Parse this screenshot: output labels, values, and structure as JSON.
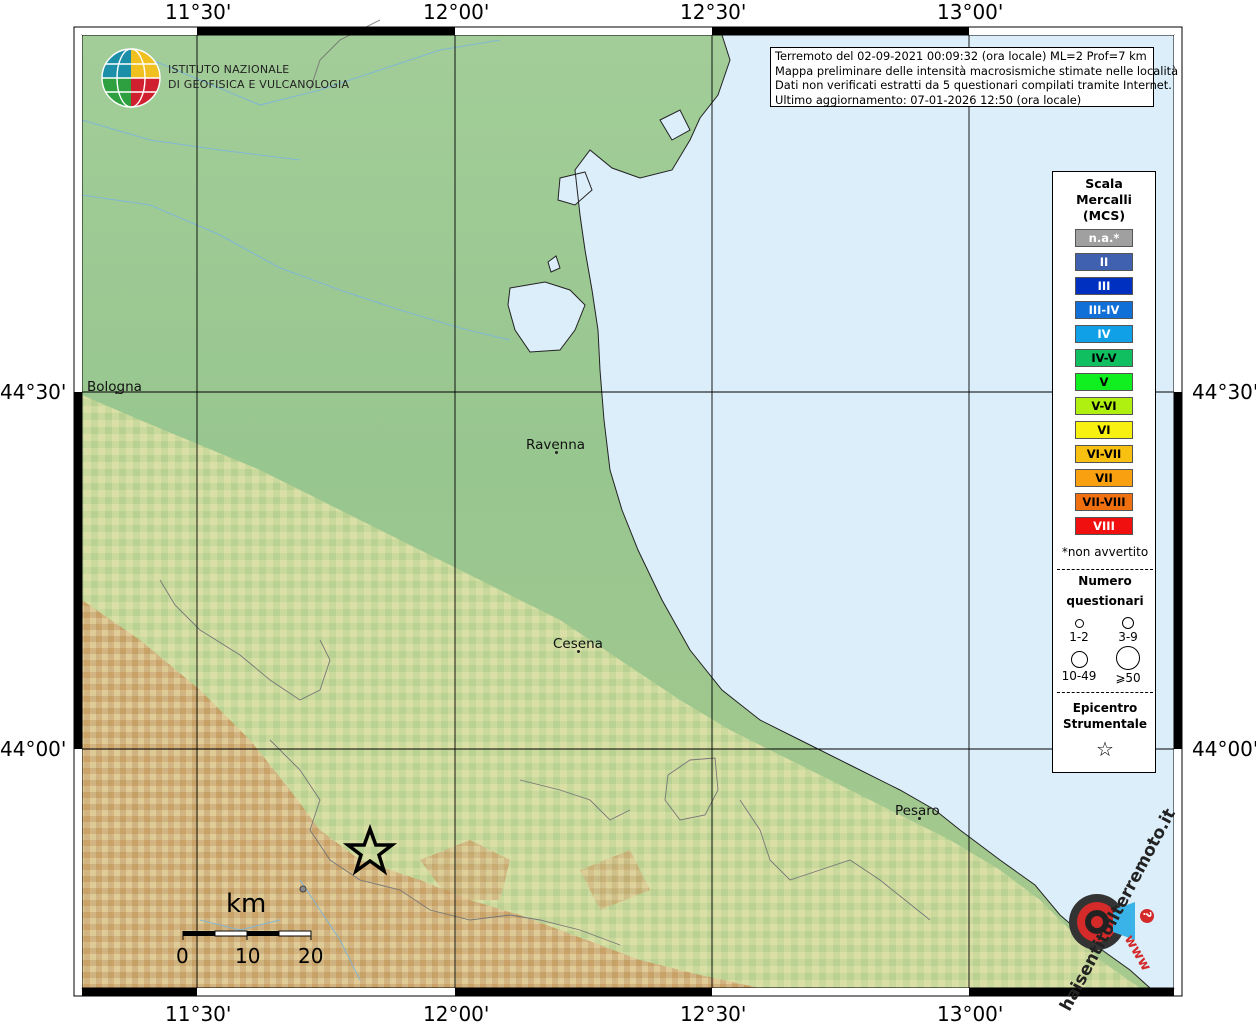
{
  "map": {
    "coord_labels": {
      "top": [
        "11°30'",
        "12°00'",
        "12°30'",
        "13°00'"
      ],
      "bottom": [
        "11°30'",
        "12°00'",
        "12°30'",
        "13°00'"
      ],
      "left": [
        "44°30'",
        "44°00'"
      ],
      "right": [
        "44°30'",
        "44°00'"
      ]
    },
    "cities": [
      "Bologna",
      "Ravenna",
      "Cesena",
      "Pesaro"
    ]
  },
  "logo": {
    "line1": "ISTITUTO NAZIONALE",
    "line2": "DI GEOFISICA E VULCANOLOGIA"
  },
  "info": {
    "line1": "Terremoto del 02-09-2021 00:09:32 (ora locale) ML=2 Prof=7 km",
    "line2": "Mappa preliminare delle intensità macrosismiche stimate nelle località",
    "line3": "Dati non verificati estratti da 5 questionari compilati tramite Internet.",
    "line4": "Ultimo aggiornamento: 07-01-2026 12:50 (ora locale)"
  },
  "legend": {
    "title1": "Scala",
    "title2": "Mercalli",
    "title3": "(MCS)",
    "items": [
      {
        "label": "n.a.*",
        "color": "#a0a0a0",
        "text_color": "#ffffff"
      },
      {
        "label": "II",
        "color": "#4060b0",
        "text_color": "#ffffff"
      },
      {
        "label": "III",
        "color": "#0030c0",
        "text_color": "#ffffff"
      },
      {
        "label": "III-IV",
        "color": "#1070d8",
        "text_color": "#ffffff"
      },
      {
        "label": "IV",
        "color": "#10a0e8",
        "text_color": "#ffffff"
      },
      {
        "label": "IV-V",
        "color": "#10c060",
        "text_color": "#000000"
      },
      {
        "label": "V",
        "color": "#10f020",
        "text_color": "#000000"
      },
      {
        "label": "V-VI",
        "color": "#b0f010",
        "text_color": "#000000"
      },
      {
        "label": "VI",
        "color": "#f8f010",
        "text_color": "#000000"
      },
      {
        "label": "VI-VII",
        "color": "#f8c010",
        "text_color": "#000000"
      },
      {
        "label": "VII",
        "color": "#f8a010",
        "text_color": "#000000"
      },
      {
        "label": "VII-VIII",
        "color": "#f07010",
        "text_color": "#000000"
      },
      {
        "label": "VIII",
        "color": "#f01010",
        "text_color": "#ffffff"
      }
    ],
    "note": "*non avvertito",
    "count_title1": "Numero",
    "count_title2": "questionari",
    "count_labels": [
      "1-2",
      "3-9",
      "10-49",
      "⩾50"
    ],
    "epi_title1": "Epicentro",
    "epi_title2": "Strumentale",
    "epi_symbol": "☆"
  },
  "scalebar": {
    "unit": "km",
    "labels": [
      "0",
      "10",
      "20"
    ]
  },
  "badge": {
    "text": "haisentitoilterremoto.it",
    "www": "www",
    "question": "?"
  },
  "colors": {
    "sea": "#dceefa",
    "lowland": "#9ecb96",
    "hills": "#c8d89a",
    "mountains": "#c8a070"
  }
}
